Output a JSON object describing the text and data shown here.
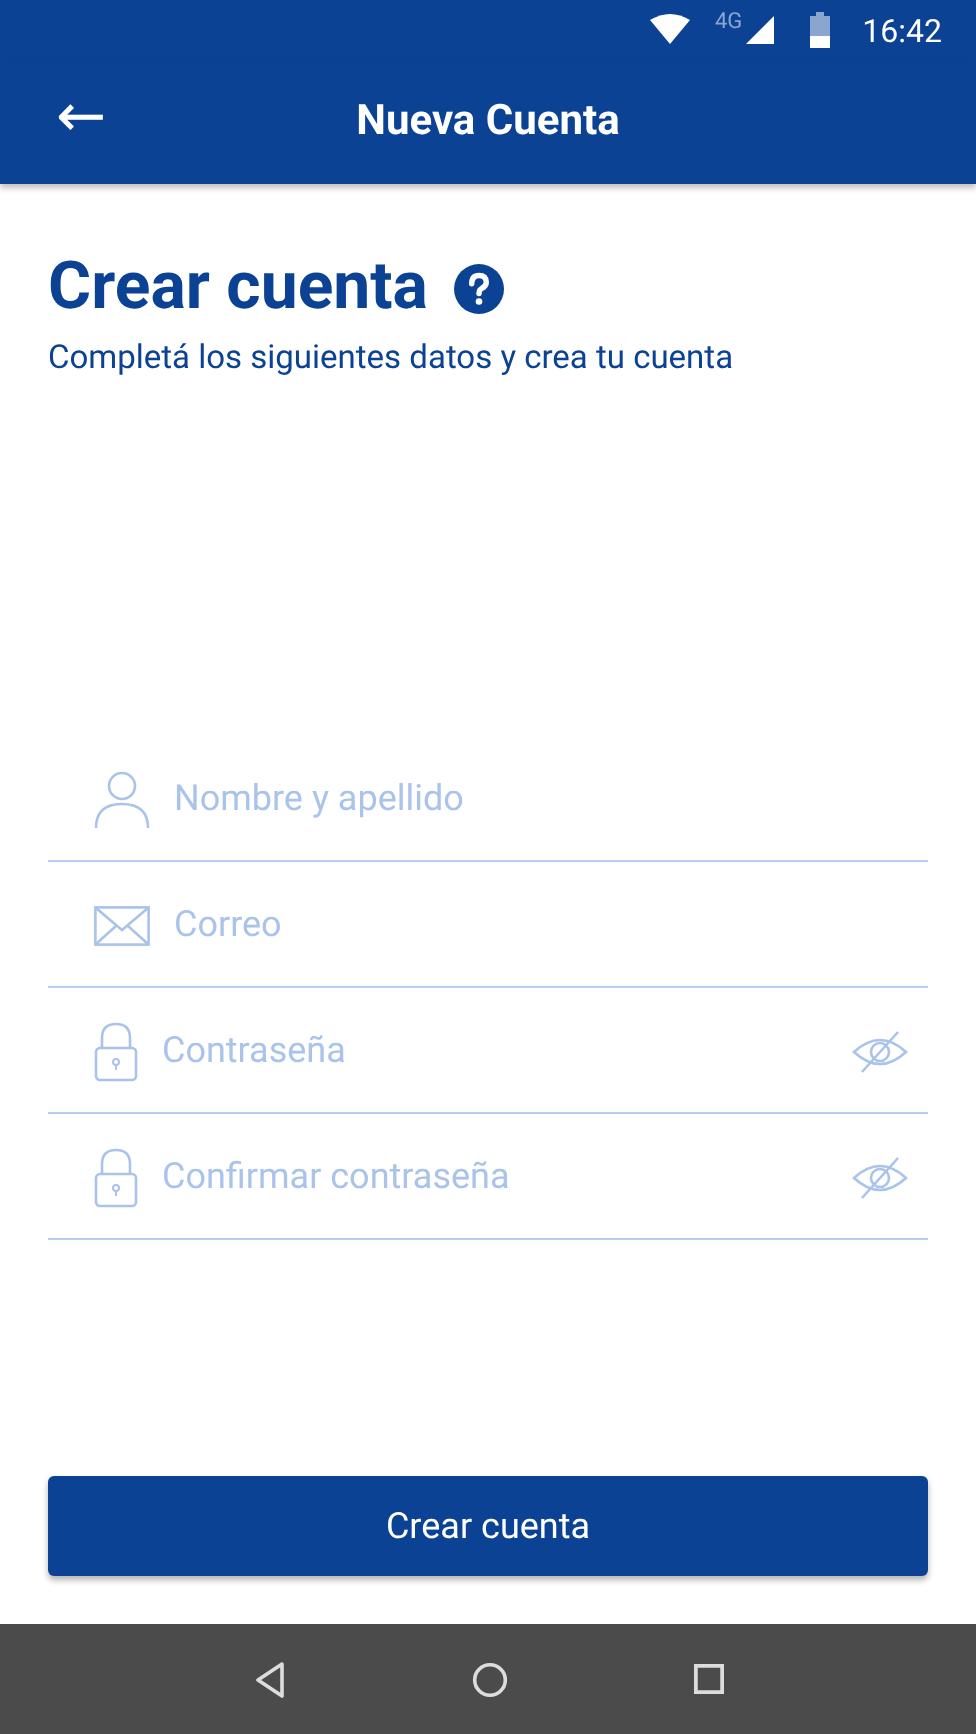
{
  "status_bar": {
    "network": "4G",
    "time": "16:42"
  },
  "app_bar": {
    "back": "←",
    "title": "Nueva Cuenta"
  },
  "heading": "Crear cuenta",
  "subtitle": "Completá los siguientes datos y crea tu cuenta",
  "fields": [
    {
      "kind": "person",
      "placeholder": "Nombre y apellido",
      "reveal_toggle": false
    },
    {
      "kind": "mail",
      "placeholder": "Correo",
      "reveal_toggle": false
    },
    {
      "kind": "lock",
      "placeholder": "Contraseña",
      "reveal_toggle": true
    },
    {
      "kind": "lock",
      "placeholder": "Confirmar contraseña",
      "reveal_toggle": true
    }
  ],
  "submit_button": "Crear cuenta"
}
